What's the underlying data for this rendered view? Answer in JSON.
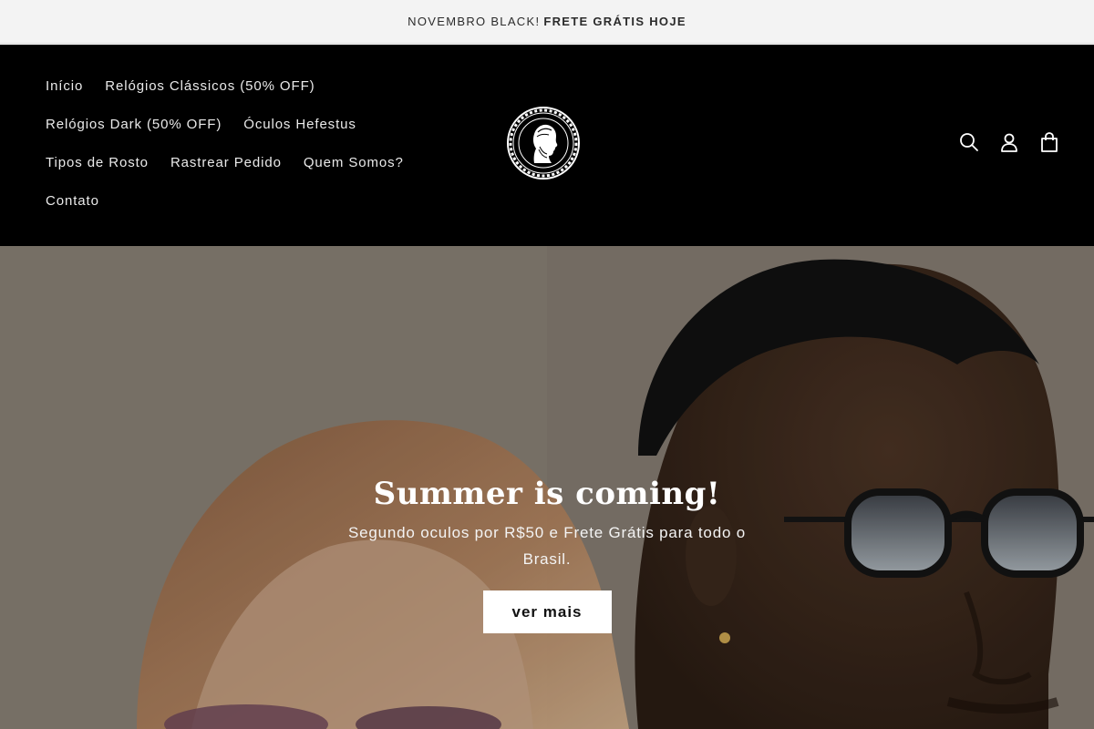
{
  "announcement": {
    "prefix": "NOVEMBRO BLACK!",
    "highlight": "FRETE GRÁTIS HOJE"
  },
  "nav": {
    "items": [
      "Início",
      "Relógios Clássicos (50% OFF)",
      "Relógios Dark (50% OFF)",
      "Óculos Hefestus",
      "Tipos de Rosto",
      "Rastrear Pedido",
      "Quem Somos?",
      "Contato"
    ]
  },
  "header": {
    "icons": [
      "search-icon",
      "account-icon",
      "cart-icon"
    ]
  },
  "hero": {
    "title": "Summer is coming!",
    "subtitle": "Segundo oculos por R$50 e Frete Grátis para todo o Brasil.",
    "button_label": "ver mais"
  },
  "colors": {
    "announcement_bg": "#f3f3f3",
    "header_bg": "#000000",
    "nav_text": "#eaeaea",
    "button_bg": "#ffffff"
  }
}
